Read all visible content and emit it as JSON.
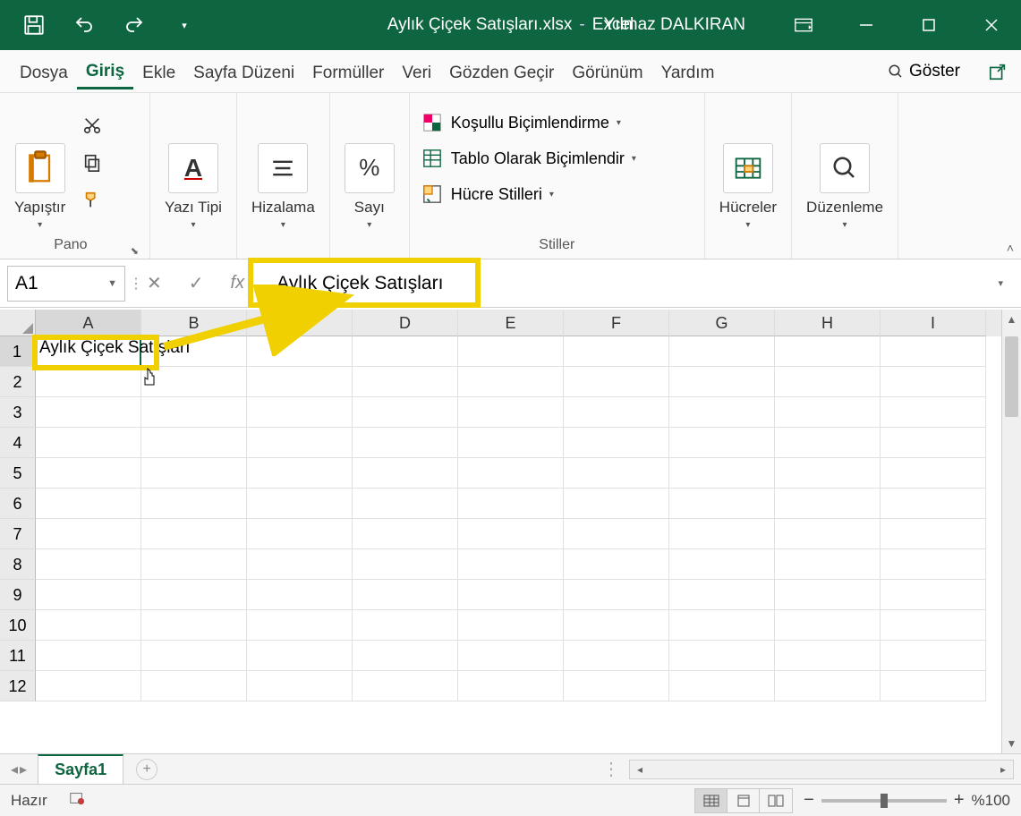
{
  "titlebar": {
    "filename": "Aylık Çiçek Satışları.xlsx",
    "separator": "-",
    "app": "Excel",
    "user": "Yılmaz DALKIRAN"
  },
  "tabs": {
    "items": [
      "Dosya",
      "Giriş",
      "Ekle",
      "Sayfa Düzeni",
      "Formüller",
      "Veri",
      "Gözden Geçir",
      "Görünüm",
      "Yardım"
    ],
    "active_index": 1,
    "tell_me": "Göster"
  },
  "ribbon": {
    "pano": {
      "label": "Pano",
      "paste": "Yapıştır"
    },
    "yazi": {
      "label": "Yazı Tipi"
    },
    "hizalama": {
      "label": "Hizalama"
    },
    "sayi": {
      "label": "Sayı"
    },
    "stiller": {
      "group_label": "Stiller",
      "kosullu": "Koşullu Biçimlendirme",
      "tablo": "Tablo Olarak Biçimlendir",
      "hucre": "Hücre Stilleri"
    },
    "hucreler": {
      "label": "Hücreler"
    },
    "duzenleme": {
      "label": "Düzenleme"
    }
  },
  "formula_bar": {
    "name_box": "A1",
    "fx_prefix": "fx",
    "value": "Aylık Çiçek Satışları"
  },
  "grid": {
    "columns": [
      "A",
      "B",
      "C",
      "D",
      "E",
      "F",
      "G",
      "H",
      "I"
    ],
    "row_count": 12,
    "a1_value": "Aylık Çiçek Satışları"
  },
  "sheets": {
    "active": "Sayfa1"
  },
  "statusbar": {
    "ready": "Hazır",
    "zoom": "%100"
  }
}
